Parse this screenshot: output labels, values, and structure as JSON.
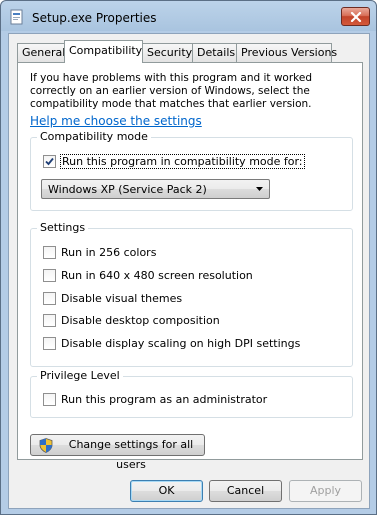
{
  "window": {
    "title": "Setup.exe Properties"
  },
  "tabs": [
    {
      "label": "General"
    },
    {
      "label": "Compatibility"
    },
    {
      "label": "Security"
    },
    {
      "label": "Details"
    },
    {
      "label": "Previous Versions"
    }
  ],
  "active_tab": "Compatibility",
  "intro_text": "If you have problems with this program and it worked correctly on an earlier version of Windows, select the compatibility mode that matches that earlier version.",
  "help_link": "Help me choose the settings",
  "compat_group": {
    "title": "Compatibility mode",
    "checkbox_label": "Run this program in compatibility mode for:",
    "checked": true,
    "selected_mode": "Windows XP (Service Pack 2)"
  },
  "settings_group": {
    "title": "Settings",
    "items": [
      {
        "label": "Run in 256 colors",
        "checked": false
      },
      {
        "label": "Run in 640 x 480 screen resolution",
        "checked": false
      },
      {
        "label": "Disable visual themes",
        "checked": false
      },
      {
        "label": "Disable desktop composition",
        "checked": false
      },
      {
        "label": "Disable display scaling on high DPI settings",
        "checked": false
      }
    ]
  },
  "privilege_group": {
    "title": "Privilege Level",
    "items": [
      {
        "label": "Run this program as an administrator",
        "checked": false
      }
    ]
  },
  "change_all_users_button": "Change settings for all users",
  "dialog_buttons": {
    "ok": "OK",
    "cancel": "Cancel",
    "apply": "Apply"
  },
  "colors": {
    "link": "#0066cc",
    "close_button": "#c2442a",
    "title_bar": "#a9c4df"
  }
}
